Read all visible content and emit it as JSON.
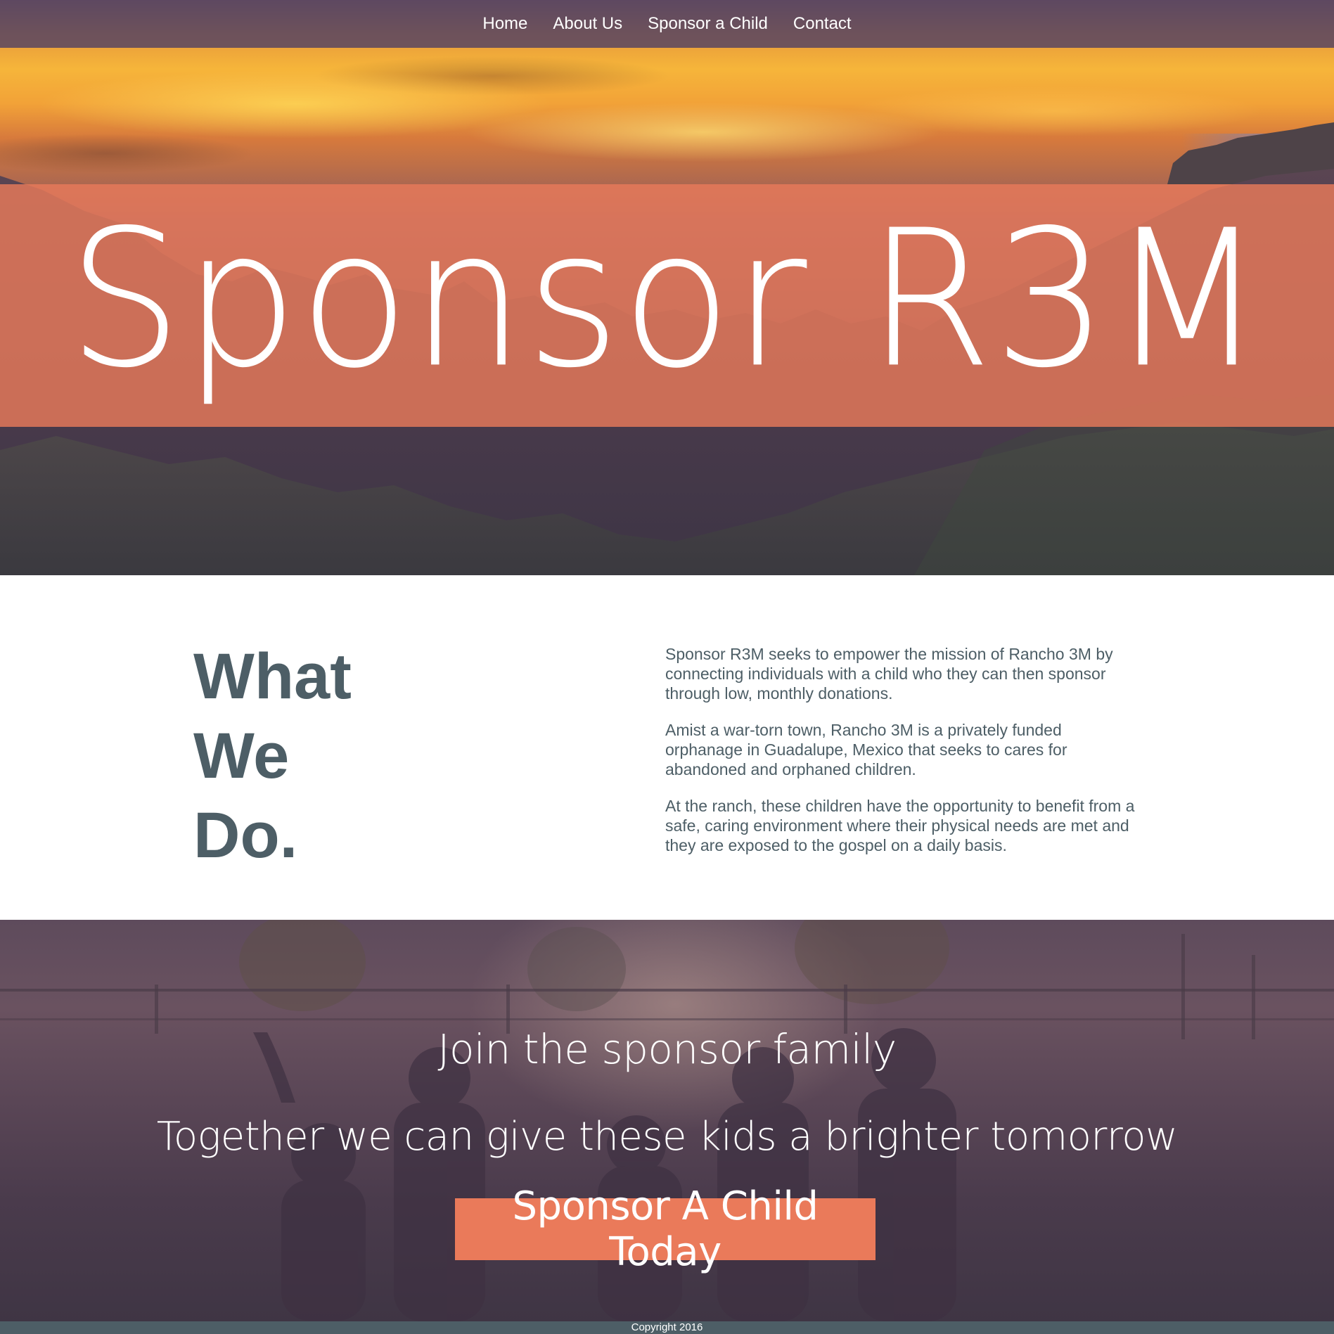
{
  "nav": {
    "items": [
      {
        "label": "Home"
      },
      {
        "label": "About Us"
      },
      {
        "label": "Sponsor a Child"
      },
      {
        "label": "Contact"
      }
    ]
  },
  "hero": {
    "title": "Sponsor R3M"
  },
  "what": {
    "heading": [
      "What",
      "We",
      "Do."
    ],
    "paragraphs": [
      "Sponsor R3M seeks to empower the mission of Rancho 3M by connecting individuals with a child who they can then sponsor through low, monthly donations.",
      "Amist a war-torn town, Rancho 3M is a privately funded orphanage in Guadalupe, Mexico that seeks to cares for abandoned and orphaned children.",
      "At the ranch, these children have the opportunity to benefit from a safe, caring environment where their physical needs are met and they are exposed to the gospel on a daily basis."
    ]
  },
  "join": {
    "title": "Join the sponsor family",
    "subtitle": "Together we can give these kids a brighter tomorrow",
    "button_label": "Sponsor A Child Today"
  },
  "footer": {
    "copyright": "Copyright 2016"
  },
  "colors": {
    "accent": "#ea7a5a",
    "text_slate": "#4d5e66",
    "nav_bg": "#5c4860"
  }
}
